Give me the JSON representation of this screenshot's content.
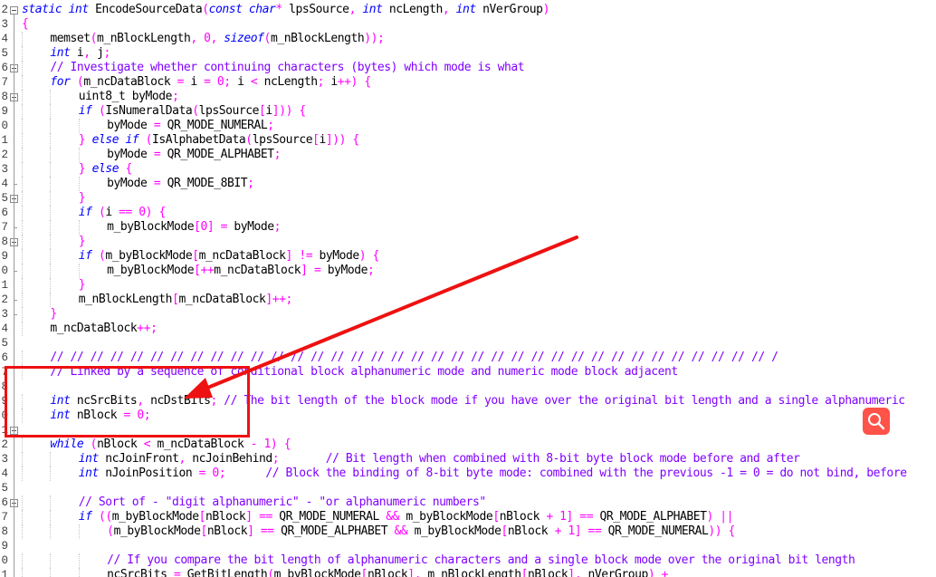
{
  "editor": {
    "line_numbers": [
      "2",
      "3",
      "4",
      "5",
      "6",
      "7",
      "8",
      "9",
      "0",
      "1",
      "2",
      "3",
      "4",
      "5",
      "6",
      "7",
      "8",
      "9",
      "0",
      "1",
      "2",
      "3",
      "4",
      "5",
      "6",
      "7",
      "8",
      "9",
      "0",
      "1",
      "2",
      "3",
      "4",
      "5",
      "6",
      "7",
      "8",
      "9",
      "0",
      "1"
    ],
    "lines": [
      "static int EncodeSourceData(const char* lpsSource, int ncLength, int nVerGroup)",
      "{",
      "memset(m_nBlockLength, 0, sizeof(m_nBlockLength));",
      "int i, j;",
      "// Investigate whether continuing characters (bytes) which mode is what",
      "for (m_ncDataBlock = i = 0; i < ncLength; i++) {",
      "uint8_t byMode;",
      "if (IsNumeralData(lpsSource[i])) {",
      "byMode = QR_MODE_NUMERAL;",
      "} else if (IsAlphabetData(lpsSource[i])) {",
      "byMode = QR_MODE_ALPHABET;",
      "} else {",
      "byMode = QR_MODE_8BIT;",
      "}",
      "if (i == 0) {",
      "m_byBlockMode[0] = byMode;",
      "}",
      "if (m_byBlockMode[m_ncDataBlock] != byMode) {",
      "m_byBlockMode[++m_ncDataBlock] = byMode;",
      "}",
      "m_nBlockLength[m_ncDataBlock]++;",
      "}",
      "m_ncDataBlock++;",
      "",
      "// // // // // // // // // // // // // // // // // // // // // // // // // // // // // // // // // // // // /",
      "// Linked by a sequence of conditional block alphanumeric mode and numeric mode block adjacent",
      "",
      "int ncSrcBits, ncDstBits; // The bit length of the block mode if you have over the original bit length and a single alphanumeric",
      "int nBlock = 0;",
      "",
      "while (nBlock < m_ncDataBlock - 1) {",
      "int ncJoinFront, ncJoinBehind;       // Bit length when combined with 8-bit byte block mode before and after",
      "int nJoinPosition = 0;      // Block the binding of 8-bit byte mode: combined with the previous -1 = 0 = do not bind, before",
      "",
      "// Sort of - \"digit alphanumeric\" - \"or alphanumeric numbers\"",
      "if ((m_byBlockMode[nBlock] == QR_MODE_NUMERAL && m_byBlockMode[nBlock + 1] == QR_MODE_ALPHABET) ||",
      "(m_byBlockMode[nBlock] == QR_MODE_ALPHABET && m_byBlockMode[nBlock + 1] == QR_MODE_NUMERAL)) {",
      "",
      "// If you compare the bit length of alphanumeric characters and a single block mode over the original bit length",
      "ncSrcBits = GetBitLength(m_byBlockMode[nBlock], m_nBlockLength[nBlock], nVerGroup) +"
    ]
  },
  "annotation": {
    "arrow_color": "#ee1111",
    "box_color": "#ee1111"
  },
  "search_button": {
    "icon": "search-icon",
    "color": "#ff3b2f"
  },
  "colors": {
    "keyword": "#0000ff",
    "number_operator": "#ff00ff",
    "comment": "#8000ff",
    "string": "#808080",
    "text": "#000000"
  }
}
